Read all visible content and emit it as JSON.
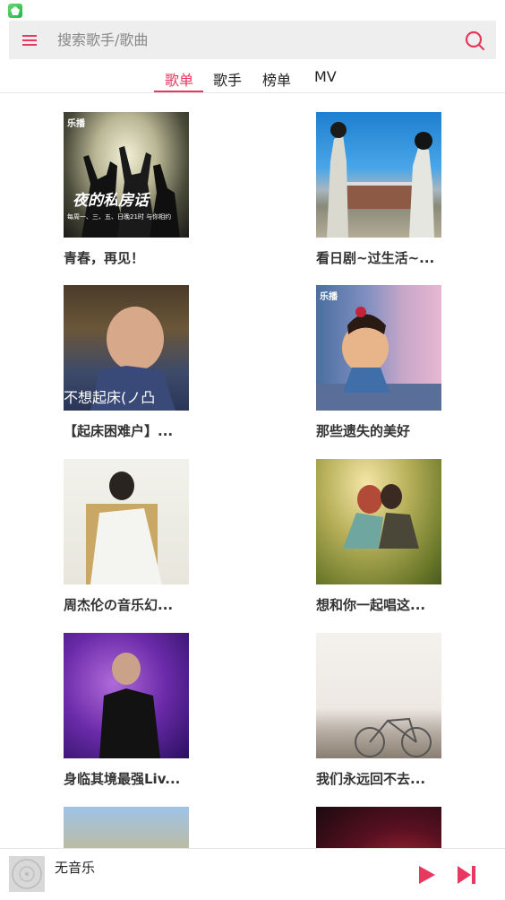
{
  "search": {
    "placeholder": "搜索歌手/歌曲"
  },
  "tabs": [
    {
      "label": "歌单"
    },
    {
      "label": "歌手"
    },
    {
      "label": "榜单"
    },
    {
      "label": "MV"
    }
  ],
  "playlists": [
    {
      "title": "青春，再见！",
      "cover_text": "夜的私房话",
      "cover_subtext": "每周一、三、五、日晚21时 与你相约",
      "cover_watermark": "乐播"
    },
    {
      "title": "看日剧~过生活~..."
    },
    {
      "title": "【起床困难户】...",
      "cover_text": "不想起床(ノ凸"
    },
    {
      "title": "那些遗失的美好",
      "cover_watermark": "乐播"
    },
    {
      "title": "周杰伦の音乐幻..."
    },
    {
      "title": "想和你一起唱这..."
    },
    {
      "title": "身临其境最强Liv..."
    },
    {
      "title": "我们永远回不去..."
    },
    {
      "title": ""
    },
    {
      "title": ""
    }
  ],
  "player": {
    "title": "无音乐"
  },
  "colors": {
    "accent": "#e8385f",
    "search_bg": "#eeeeee"
  }
}
